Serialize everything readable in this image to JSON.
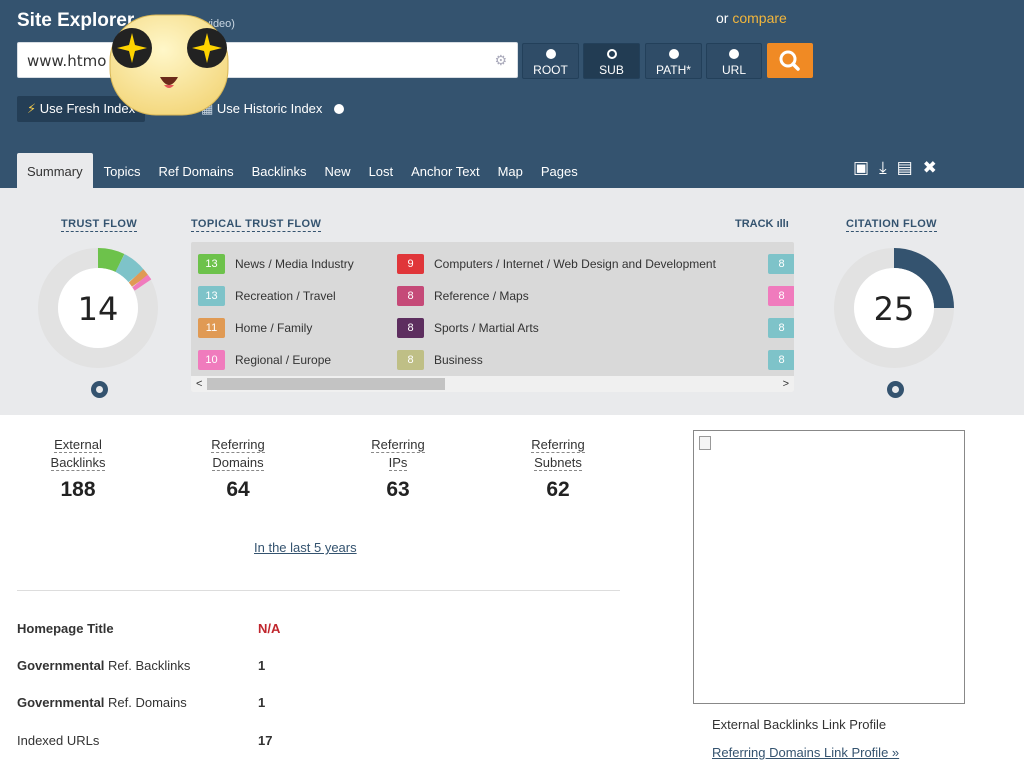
{
  "header": {
    "title": "Site Explorer",
    "video_text": "video)",
    "or_text": "or",
    "compare_label": "compare",
    "url_value": "www.htmo",
    "scope_buttons": [
      {
        "label": "ROOT",
        "active": false
      },
      {
        "label": "SUB",
        "active": true
      },
      {
        "label": "PATH*",
        "active": false
      },
      {
        "label": "URL",
        "active": false
      }
    ],
    "fresh_index_label": "Use Fresh Index",
    "historic_index_label": "Use Historic Index"
  },
  "tabs": [
    {
      "label": "Summary",
      "active": true
    },
    {
      "label": "Topics"
    },
    {
      "label": "Ref Domains"
    },
    {
      "label": "Backlinks"
    },
    {
      "label": "New"
    },
    {
      "label": "Lost"
    },
    {
      "label": "Anchor Text"
    },
    {
      "label": "Map"
    },
    {
      "label": "Pages"
    }
  ],
  "tool_icons": [
    "add-report-icon",
    "download-icon",
    "export-sheet-icon",
    "tools-icon"
  ],
  "trust_flow": {
    "label": "TRUST FLOW",
    "value": "14"
  },
  "citation_flow": {
    "label": "CITATION FLOW",
    "value": "25"
  },
  "topical": {
    "label": "TOPICAL TRUST FLOW",
    "track_label": "TRACK",
    "items": [
      {
        "value": "13",
        "label": "News / Media Industry",
        "color": "#6dc24b"
      },
      {
        "value": "13",
        "label": "Recreation / Travel",
        "color": "#7ec3c9"
      },
      {
        "value": "11",
        "label": "Home / Family",
        "color": "#e09a54"
      },
      {
        "value": "10",
        "label": "Regional / Europe",
        "color": "#f07bbd"
      },
      {
        "value": "9",
        "label": "Computers / Internet / Web Design and Development",
        "color": "#e0363a"
      },
      {
        "value": "8",
        "label": "Reference / Maps",
        "color": "#c54a78"
      },
      {
        "value": "8",
        "label": "Sports / Martial Arts",
        "color": "#5d2e5f"
      },
      {
        "value": "8",
        "label": "Business",
        "color": "#bfbf86"
      },
      {
        "value": "8",
        "label": "",
        "color": "#7ec3c9"
      },
      {
        "value": "8",
        "label": "",
        "color": "#f07bbd"
      },
      {
        "value": "8",
        "label": "",
        "color": "#7ec3c9"
      },
      {
        "value": "8",
        "label": "",
        "color": "#7ec3c9"
      }
    ]
  },
  "stats": [
    {
      "line1": "External",
      "line2": "Backlinks",
      "value": "188"
    },
    {
      "line1": "Referring",
      "line2": "Domains",
      "value": "64"
    },
    {
      "line1": "Referring",
      "line2": "IPs",
      "value": "63"
    },
    {
      "line1": "Referring",
      "line2": "Subnets",
      "value": "62"
    }
  ],
  "last5_label": "In the last 5 years",
  "info_rows": [
    {
      "bold": "Homepage Title",
      "rest": "",
      "value": "N/A"
    },
    {
      "bold": "Governmental",
      "rest": " Ref. Backlinks",
      "value": "1"
    },
    {
      "bold": "Governmental",
      "rest": " Ref. Domains",
      "value": "1"
    },
    {
      "bold": "",
      "rest": "Indexed URLs",
      "value": "17"
    }
  ],
  "external_profile_label": "External Backlinks Link Profile",
  "referring_profile_label": "Referring Domains Link Profile »"
}
